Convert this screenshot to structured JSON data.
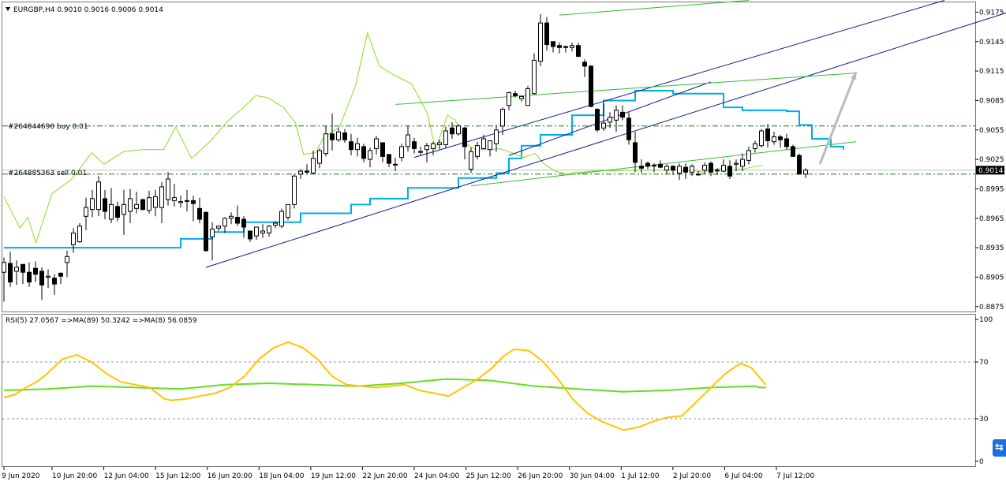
{
  "header": {
    "symbol_line": "EURGBP,H4  0.9010 0.9016 0.9006 0.9014"
  },
  "orders": [
    {
      "label": "#264844690 buy 0.01",
      "price": 0.9059
    },
    {
      "label": "#264885363 sell 0.01",
      "price": 0.901
    }
  ],
  "current_price": {
    "value": 0.9014,
    "label": "0.9014"
  },
  "price_axis": {
    "min": 0.887,
    "max": 0.9185,
    "ticks": [
      "0.9175",
      "0.9145",
      "0.9115",
      "0.9085",
      "0.9055",
      "0.9025",
      "0.8995",
      "0.8965",
      "0.8935",
      "0.8905",
      "0.8875"
    ]
  },
  "time_axis": {
    "labels": [
      "9 Jun 2020",
      "10 Jun 20:00",
      "12 Jun 04:00",
      "15 Jun 12:00",
      "16 Jun 20:00",
      "18 Jun 04:00",
      "19 Jun 12:00",
      "22 Jun 20:00",
      "24 Jun 04:00",
      "25 Jun 12:00",
      "26 Jun 20:00",
      "30 Jun 04:00",
      "1 Jul 12:00",
      "2 Jul 20:00",
      "6 Jul 04:00",
      "7 Jul 12:00"
    ]
  },
  "rsi_panel": {
    "legend": "RSI(5) 27.0567  =>MA(89) 50.3242  =>MA(8) 56.0859",
    "ticks": [
      "100",
      "70",
      "30",
      "0"
    ],
    "levels": [
      70,
      30
    ],
    "rsi_color": "#ffc400",
    "ma_color": "#66dd22"
  },
  "colors": {
    "bull_candle": "#ffffff",
    "bear_candle": "#000000",
    "baseline": "#00aaee",
    "channel_blue": "#0a1e8c",
    "channel_green": "#33bb33",
    "lime_line": "#88dd22",
    "order_line": "#117711",
    "arrow": "#bbbbbb"
  },
  "chart_data": {
    "type": "candlestick",
    "symbol": "EURGBP",
    "timeframe": "H4",
    "ohlc": [
      [
        0.891,
        0.8925,
        0.888,
        0.892
      ],
      [
        0.8919,
        0.8931,
        0.8895,
        0.89
      ],
      [
        0.8911,
        0.8922,
        0.8897,
        0.8915
      ],
      [
        0.8918,
        0.8916,
        0.8898,
        0.891
      ],
      [
        0.891,
        0.892,
        0.8895,
        0.89
      ],
      [
        0.8914,
        0.8921,
        0.89,
        0.8908
      ],
      [
        0.8911,
        0.8915,
        0.8882,
        0.8897
      ],
      [
        0.8905,
        0.8913,
        0.8894,
        0.8906
      ],
      [
        0.8904,
        0.8908,
        0.8887,
        0.8898
      ],
      [
        0.8909,
        0.891,
        0.8898,
        0.8906
      ],
      [
        0.892,
        0.8932,
        0.8905,
        0.8926
      ],
      [
        0.8938,
        0.8955,
        0.893,
        0.895
      ],
      [
        0.8941,
        0.896,
        0.894,
        0.8957
      ],
      [
        0.8967,
        0.8986,
        0.8953,
        0.8976
      ],
      [
        0.8974,
        0.8994,
        0.8966,
        0.8985
      ],
      [
        0.8974,
        0.9008,
        0.8967,
        0.9002
      ],
      [
        0.8985,
        0.8994,
        0.8964,
        0.8972
      ],
      [
        0.8964,
        0.8996,
        0.896,
        0.8979
      ],
      [
        0.8977,
        0.8982,
        0.8962,
        0.8966
      ],
      [
        0.8969,
        0.8994,
        0.8948,
        0.8979
      ],
      [
        0.8972,
        0.8995,
        0.896,
        0.8985
      ],
      [
        0.8975,
        0.8992,
        0.897,
        0.8979
      ],
      [
        0.8984,
        0.8985,
        0.8973,
        0.8974
      ],
      [
        0.8973,
        0.8993,
        0.897,
        0.8986
      ],
      [
        0.8976,
        0.8994,
        0.8967,
        0.8987
      ],
      [
        0.8976,
        0.9002,
        0.896,
        0.8997
      ],
      [
        0.8984,
        0.9012,
        0.8978,
        0.9005
      ],
      [
        0.8983,
        0.9,
        0.8977,
        0.8986
      ],
      [
        0.8981,
        0.8988,
        0.8976,
        0.8982
      ],
      [
        0.8983,
        0.8994,
        0.8972,
        0.8983
      ],
      [
        0.8983,
        0.8988,
        0.8962,
        0.898
      ],
      [
        0.8975,
        0.8986,
        0.896,
        0.8964
      ],
      [
        0.8971,
        0.8972,
        0.8931,
        0.8932
      ],
      [
        0.8946,
        0.8961,
        0.8922,
        0.8954
      ],
      [
        0.8955,
        0.8957,
        0.8952,
        0.8957
      ],
      [
        0.8957,
        0.8966,
        0.895,
        0.8965
      ],
      [
        0.8965,
        0.8971,
        0.8959,
        0.8967
      ],
      [
        0.8966,
        0.8978,
        0.8957,
        0.896
      ],
      [
        0.8964,
        0.8967,
        0.8945,
        0.8956
      ],
      [
        0.8952,
        0.8952,
        0.8941,
        0.8944
      ],
      [
        0.8947,
        0.8956,
        0.8943,
        0.8956
      ],
      [
        0.895,
        0.8959,
        0.8945,
        0.8952
      ],
      [
        0.895,
        0.8958,
        0.8946,
        0.8957
      ],
      [
        0.8958,
        0.8962,
        0.8955,
        0.896
      ],
      [
        0.8957,
        0.8975,
        0.8955,
        0.8972
      ],
      [
        0.8966,
        0.8979,
        0.8963,
        0.8979
      ],
      [
        0.8979,
        0.901,
        0.8975,
        0.9008
      ],
      [
        0.901,
        0.9015,
        0.9005,
        0.9013
      ],
      [
        0.9013,
        0.902,
        0.901,
        0.9012
      ],
      [
        0.9011,
        0.9034,
        0.901,
        0.9026
      ],
      [
        0.9021,
        0.9036,
        0.9016,
        0.9034
      ],
      [
        0.9031,
        0.9059,
        0.9028,
        0.9051
      ],
      [
        0.9051,
        0.9072,
        0.9034,
        0.9045
      ],
      [
        0.9045,
        0.9057,
        0.9043,
        0.9053
      ],
      [
        0.9052,
        0.9056,
        0.9042,
        0.9045
      ],
      [
        0.9043,
        0.9051,
        0.9029,
        0.9035
      ],
      [
        0.9035,
        0.9047,
        0.9028,
        0.9041
      ],
      [
        0.9038,
        0.9041,
        0.9022,
        0.9026
      ],
      [
        0.9025,
        0.9037,
        0.9017,
        0.9034
      ],
      [
        0.9036,
        0.9049,
        0.903,
        0.9046
      ],
      [
        0.9042,
        0.9042,
        0.9022,
        0.9028
      ],
      [
        0.903,
        0.903,
        0.9017,
        0.9021
      ],
      [
        0.902,
        0.9027,
        0.9013,
        0.902
      ],
      [
        0.9027,
        0.9041,
        0.9023,
        0.9038
      ],
      [
        0.9038,
        0.9059,
        0.9033,
        0.905
      ],
      [
        0.9043,
        0.9047,
        0.9031,
        0.9036
      ],
      [
        0.9033,
        0.9038,
        0.9029,
        0.9033
      ],
      [
        0.9035,
        0.9042,
        0.9022,
        0.9039
      ],
      [
        0.9036,
        0.9043,
        0.9029,
        0.9041
      ],
      [
        0.904,
        0.9045,
        0.9035,
        0.9042
      ],
      [
        0.904,
        0.9058,
        0.9036,
        0.9054
      ],
      [
        0.9057,
        0.9063,
        0.9046,
        0.9051
      ],
      [
        0.9051,
        0.9061,
        0.9049,
        0.9059
      ],
      [
        0.9057,
        0.9058,
        0.9025,
        0.9038
      ],
      [
        0.9015,
        0.9037,
        0.9011,
        0.9033
      ],
      [
        0.9028,
        0.9043,
        0.9025,
        0.9039
      ],
      [
        0.9036,
        0.905,
        0.9035,
        0.9046
      ],
      [
        0.9035,
        0.9044,
        0.9028,
        0.9044
      ],
      [
        0.9041,
        0.906,
        0.9033,
        0.9055
      ],
      [
        0.9059,
        0.9078,
        0.905,
        0.9076
      ],
      [
        0.908,
        0.9094,
        0.9075,
        0.9093
      ],
      [
        0.9092,
        0.9095,
        0.9088,
        0.909
      ],
      [
        0.9087,
        0.909,
        0.9084,
        0.9089
      ],
      [
        0.908,
        0.91,
        0.9081,
        0.9097
      ],
      [
        0.9092,
        0.9133,
        0.9091,
        0.9126
      ],
      [
        0.9125,
        0.9173,
        0.912,
        0.9164
      ],
      [
        0.9164,
        0.917,
        0.9136,
        0.9142
      ],
      [
        0.9145,
        0.9144,
        0.9134,
        0.914
      ],
      [
        0.9141,
        0.9144,
        0.9133,
        0.9139
      ],
      [
        0.914,
        0.9141,
        0.9134,
        0.9139
      ],
      [
        0.9139,
        0.9144,
        0.9135,
        0.9141
      ],
      [
        0.9141,
        0.9144,
        0.9129,
        0.913
      ],
      [
        0.9124,
        0.9127,
        0.9109,
        0.912
      ],
      [
        0.912,
        0.9121,
        0.9078,
        0.9079
      ],
      [
        0.9076,
        0.9077,
        0.9053,
        0.9055
      ],
      [
        0.9057,
        0.9082,
        0.9054,
        0.9062
      ],
      [
        0.9063,
        0.9073,
        0.9057,
        0.9068
      ],
      [
        0.9065,
        0.908,
        0.9053,
        0.9075
      ],
      [
        0.9073,
        0.908,
        0.9065,
        0.9068
      ],
      [
        0.9067,
        0.9073,
        0.904,
        0.9045
      ],
      [
        0.9042,
        0.9053,
        0.9012,
        0.9022
      ],
      [
        0.9018,
        0.9025,
        0.9011,
        0.9016
      ],
      [
        0.9021,
        0.9023,
        0.9015,
        0.9018
      ],
      [
        0.9019,
        0.9021,
        0.9012,
        0.9019
      ],
      [
        0.902,
        0.9024,
        0.9016,
        0.9017
      ],
      [
        0.9014,
        0.902,
        0.901,
        0.9018
      ],
      [
        0.9018,
        0.9019,
        0.9009,
        0.9014
      ],
      [
        0.9011,
        0.9021,
        0.9004,
        0.9018
      ],
      [
        0.9017,
        0.9021,
        0.9005,
        0.9012
      ],
      [
        0.9012,
        0.902,
        0.9008,
        0.9018
      ],
      [
        0.901,
        0.9013,
        0.9008,
        0.901
      ],
      [
        0.9014,
        0.9022,
        0.901,
        0.9019
      ],
      [
        0.9021,
        0.9023,
        0.9008,
        0.9012
      ],
      [
        0.9014,
        0.9016,
        0.9009,
        0.9014
      ],
      [
        0.9013,
        0.9025,
        0.9012,
        0.9019
      ],
      [
        0.9018,
        0.9024,
        0.9005,
        0.9008
      ],
      [
        0.902,
        0.9025,
        0.9013,
        0.9021
      ],
      [
        0.9018,
        0.9031,
        0.9013,
        0.9025
      ],
      [
        0.9024,
        0.9038,
        0.902,
        0.9034
      ],
      [
        0.9036,
        0.9044,
        0.9032,
        0.9041
      ],
      [
        0.9039,
        0.9056,
        0.9037,
        0.9054
      ],
      [
        0.9056,
        0.9061,
        0.9037,
        0.9044
      ],
      [
        0.9043,
        0.9053,
        0.904,
        0.9048
      ],
      [
        0.9048,
        0.905,
        0.9037,
        0.9045
      ],
      [
        0.9046,
        0.9051,
        0.9035,
        0.9038
      ],
      [
        0.9038,
        0.904,
        0.9028,
        0.9028
      ],
      [
        0.9029,
        0.9031,
        0.901,
        0.901
      ],
      [
        0.901,
        0.9016,
        0.9006,
        0.9014
      ]
    ],
    "baseline": [
      [
        0,
        0.8935
      ],
      [
        26,
        0.8935
      ],
      [
        28,
        0.8944
      ],
      [
        33,
        0.8951
      ],
      [
        38,
        0.8961
      ],
      [
        47,
        0.897
      ],
      [
        55,
        0.8979
      ],
      [
        58,
        0.8985
      ],
      [
        64,
        0.8996
      ],
      [
        72,
        0.9006
      ],
      [
        78,
        0.9011
      ],
      [
        80,
        0.9026
      ],
      [
        82,
        0.9039
      ],
      [
        85,
        0.905
      ],
      [
        90,
        0.907
      ],
      [
        95,
        0.9085
      ],
      [
        100,
        0.9095
      ],
      [
        106,
        0.9092
      ],
      [
        112,
        0.9092
      ],
      [
        114,
        0.9078
      ],
      [
        117,
        0.9075
      ],
      [
        124,
        0.9074
      ],
      [
        126,
        0.906
      ],
      [
        128,
        0.9046
      ],
      [
        131,
        0.9038
      ],
      [
        133,
        0.9035
      ]
    ],
    "lime_line": [
      [
        0,
        0.8987
      ],
      [
        4,
        0.8955
      ],
      [
        6,
        0.8966
      ],
      [
        8,
        0.894
      ],
      [
        12,
        0.899
      ],
      [
        17,
        0.9005
      ],
      [
        22,
        0.9032
      ],
      [
        25,
        0.902
      ],
      [
        30,
        0.9033
      ],
      [
        35,
        0.9035
      ],
      [
        40,
        0.9035
      ],
      [
        43,
        0.9058
      ],
      [
        47,
        0.9026
      ],
      [
        52,
        0.9045
      ],
      [
        56,
        0.9064
      ],
      [
        60,
        0.9078
      ],
      [
        63,
        0.909
      ],
      [
        66,
        0.9088
      ],
      [
        70,
        0.9078
      ],
      [
        73,
        0.9062
      ],
      [
        75,
        0.903
      ],
      [
        78,
        0.9032
      ],
      [
        80,
        0.9047
      ],
      [
        84,
        0.9058
      ],
      [
        88,
        0.91
      ],
      [
        91,
        0.9154
      ],
      [
        94,
        0.912
      ],
      [
        98,
        0.911
      ],
      [
        102,
        0.9102
      ],
      [
        106,
        0.9072
      ],
      [
        108,
        0.9035
      ],
      [
        111,
        0.907
      ],
      [
        113,
        0.9065
      ],
      [
        116,
        0.904
      ],
      [
        118,
        0.9035
      ],
      [
        122,
        0.9035
      ],
      [
        124,
        0.9036
      ],
      [
        127,
        0.9032
      ],
      [
        130,
        0.9027
      ],
      [
        133,
        0.9031
      ],
      [
        135,
        0.9021
      ],
      [
        138,
        0.9013
      ],
      [
        141,
        0.901
      ],
      [
        143,
        0.9012
      ],
      [
        145,
        0.9012
      ],
      [
        147,
        0.9013
      ],
      [
        150,
        0.9014
      ],
      [
        153,
        0.9013
      ],
      [
        156,
        0.9014
      ],
      [
        159,
        0.9014
      ],
      [
        162,
        0.9014
      ],
      [
        165,
        0.9014
      ],
      [
        168,
        0.9014
      ],
      [
        170,
        0.9013
      ],
      [
        172,
        0.9014
      ],
      [
        175,
        0.9012
      ],
      [
        177,
        0.9014
      ],
      [
        180,
        0.9016
      ],
      [
        182,
        0.9014
      ],
      [
        185,
        0.9015
      ],
      [
        187,
        0.9017
      ],
      [
        190,
        0.9019
      ]
    ],
    "rsi": [
      [
        0,
        45
      ],
      [
        3,
        47
      ],
      [
        6,
        52
      ],
      [
        9,
        56
      ],
      [
        12,
        62
      ],
      [
        16,
        72
      ],
      [
        20,
        75
      ],
      [
        24,
        70
      ],
      [
        28,
        62
      ],
      [
        32,
        56
      ],
      [
        36,
        54
      ],
      [
        40,
        52
      ],
      [
        44,
        44
      ],
      [
        46,
        43
      ],
      [
        50,
        44
      ],
      [
        54,
        46
      ],
      [
        58,
        48
      ],
      [
        62,
        52
      ],
      [
        66,
        60
      ],
      [
        70,
        72
      ],
      [
        74,
        80
      ],
      [
        78,
        84
      ],
      [
        82,
        80
      ],
      [
        86,
        72
      ],
      [
        90,
        60
      ],
      [
        94,
        54
      ],
      [
        98,
        53
      ],
      [
        102,
        52
      ],
      [
        106,
        53
      ],
      [
        110,
        54
      ],
      [
        114,
        50
      ],
      [
        118,
        48
      ],
      [
        122,
        46
      ],
      [
        126,
        52
      ],
      [
        130,
        58
      ],
      [
        134,
        66
      ],
      [
        137,
        74
      ],
      [
        140,
        79
      ],
      [
        144,
        78
      ],
      [
        148,
        70
      ],
      [
        152,
        58
      ],
      [
        156,
        44
      ],
      [
        160,
        34
      ],
      [
        164,
        28
      ],
      [
        168,
        24
      ],
      [
        170,
        22
      ],
      [
        174,
        24
      ],
      [
        178,
        28
      ],
      [
        182,
        31
      ],
      [
        186,
        32
      ],
      [
        190,
        42
      ],
      [
        194,
        52
      ],
      [
        198,
        62
      ],
      [
        202,
        69
      ],
      [
        205,
        66
      ],
      [
        209,
        54
      ]
    ],
    "rsi_ma": [
      [
        0,
        50
      ],
      [
        20,
        51
      ],
      [
        40,
        53
      ],
      [
        60,
        52
      ],
      [
        80,
        51
      ],
      [
        100,
        54
      ],
      [
        120,
        55
      ],
      [
        140,
        54
      ],
      [
        160,
        53
      ],
      [
        180,
        55
      ],
      [
        200,
        58
      ],
      [
        220,
        57
      ],
      [
        240,
        53
      ],
      [
        260,
        51
      ],
      [
        270,
        50
      ],
      [
        280,
        49
      ],
      [
        300,
        50
      ],
      [
        320,
        52
      ],
      [
        340,
        53
      ],
      [
        342,
        52
      ],
      [
        345,
        52
      ]
    ],
    "channels": [
      {
        "color": "blue",
        "from": [
          32,
          0.8915
        ],
        "to": [
          165,
          0.9187
        ]
      },
      {
        "color": "blue",
        "from": [
          65,
          0.9027
        ],
        "to": [
          149,
          0.9187
        ]
      },
      {
        "color": "blue",
        "from": [
          80,
          0.9029
        ],
        "to": [
          112,
          0.9104
        ]
      },
      {
        "color": "green",
        "from": [
          62,
          0.9081
        ],
        "to": [
          135,
          0.9113
        ]
      },
      {
        "color": "green",
        "from": [
          74,
          0.8998
        ],
        "to": [
          135,
          0.9043
        ]
      },
      {
        "color": "green",
        "from": [
          88,
          0.9172
        ],
        "to": [
          118,
          0.9187
        ]
      }
    ],
    "arrow": {
      "from": [
        129,
        0.902
      ],
      "to": [
        135,
        0.9114
      ]
    }
  }
}
